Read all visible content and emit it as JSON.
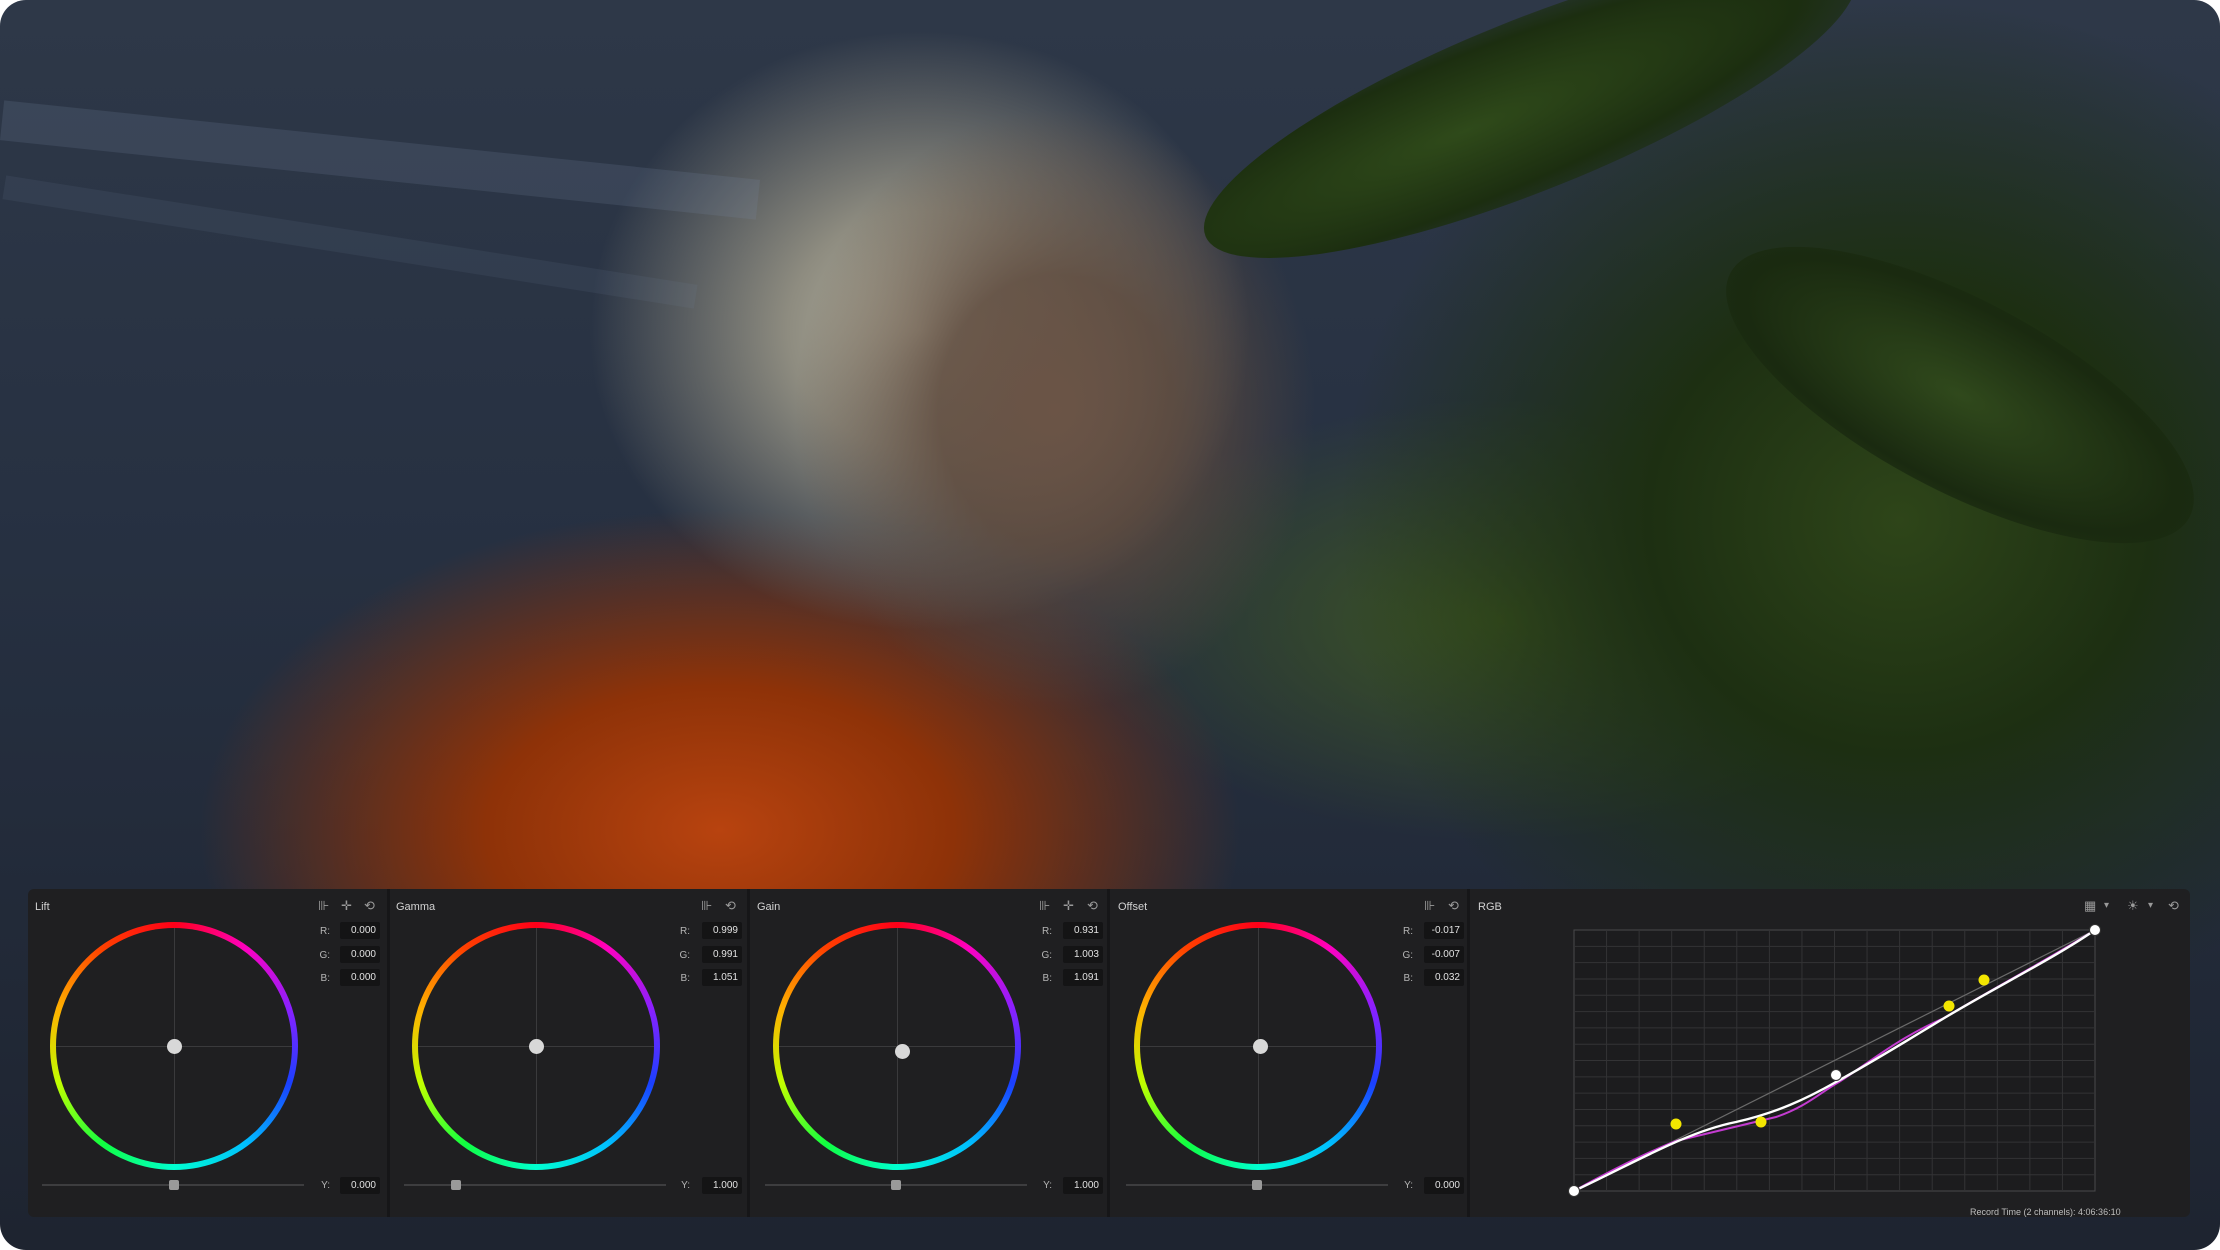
{
  "wheels": [
    {
      "title": "Lift",
      "r": "0.000",
      "g": "0.000",
      "b": "0.000",
      "y": "0.000",
      "icons": [
        "sliders-icon",
        "crosshair-icon",
        "reset-icon"
      ]
    },
    {
      "title": "Gamma",
      "r": "0.999",
      "g": "0.991",
      "b": "1.051",
      "y": "1.000",
      "icons": [
        "sliders-icon",
        "reset-icon"
      ]
    },
    {
      "title": "Gain",
      "r": "0.931",
      "g": "1.003",
      "b": "1.091",
      "y": "1.000",
      "icons": [
        "sliders-icon",
        "crosshair-icon",
        "reset-icon"
      ]
    },
    {
      "title": "Offset",
      "r": "-0.017",
      "g": "-0.007",
      "b": "0.032",
      "y": "0.000",
      "icons": [
        "sliders-icon",
        "reset-icon"
      ]
    }
  ],
  "channel_labels": {
    "r": "R:",
    "g": "G:",
    "b": "B:",
    "y": "Y:"
  },
  "curves": {
    "title": "RGB"
  },
  "icons_glyphs": {
    "sliders": "⊪",
    "crosshair": "✛",
    "reset": "⟲",
    "grid": "▦",
    "dropdown": "▾",
    "sun": "☀"
  },
  "colors": {
    "panel": "#1f1f21",
    "curve_white": "#ffffff",
    "curve_magenta": "#c33bd0",
    "point_yellow": "#f3e600"
  },
  "status": {
    "record_time": "Record Time (2 channels): 4:06:36:10"
  }
}
